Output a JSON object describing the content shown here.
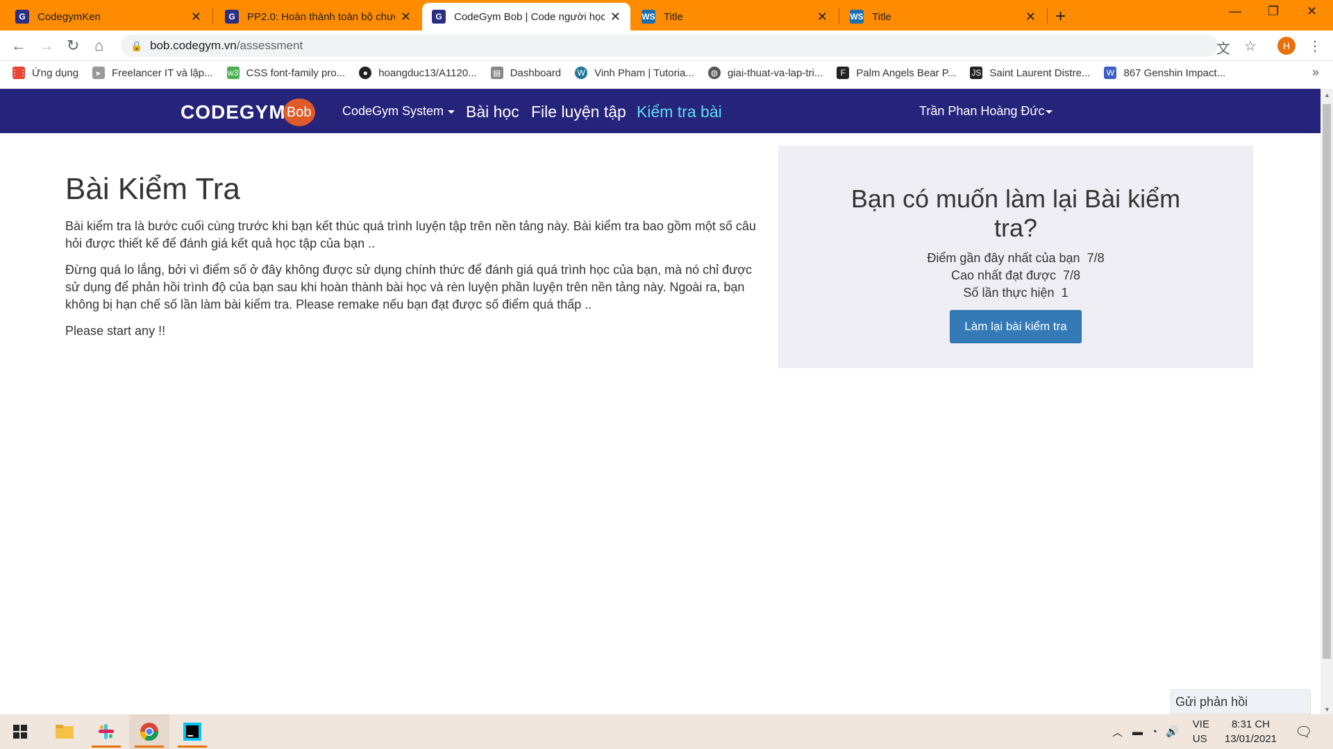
{
  "browser": {
    "tabs": [
      {
        "title": "CodegymKen",
        "icon": "codegym-favicon-icon"
      },
      {
        "title": "PP2.0: Hoàn thành toàn bộ chươ",
        "icon": "codegym-favicon-icon"
      },
      {
        "title": "CodeGym Bob | Code người học",
        "icon": "codegym-favicon-icon",
        "active": true
      },
      {
        "title": "Title",
        "icon": "webstorm-favicon-icon"
      },
      {
        "title": "Title",
        "icon": "webstorm-favicon-icon"
      }
    ],
    "address": {
      "domain": "bob.codegym.vn",
      "path": "/assessment"
    },
    "profile_initial": "H",
    "bookmarks": [
      {
        "label": "Ứng dụng",
        "icon": "apps-grid-icon"
      },
      {
        "label": "Freelancer IT và lập...",
        "icon": "freelancer-icon"
      },
      {
        "label": "CSS font-family pro...",
        "icon": "w3schools-icon"
      },
      {
        "label": "hoangduc13/A1120...",
        "icon": "github-icon"
      },
      {
        "label": "Dashboard",
        "icon": "dashboard-icon"
      },
      {
        "label": "Vinh Pham | Tutoria...",
        "icon": "wordpress-icon"
      },
      {
        "label": "giai-thuat-va-lap-tri...",
        "icon": "globe-icon"
      },
      {
        "label": "Palm Angels Bear P...",
        "icon": "farfetch-icon"
      },
      {
        "label": "Saint Laurent Distre...",
        "icon": "js-icon"
      },
      {
        "label": "867 Genshin Impact...",
        "icon": "w-icon"
      }
    ]
  },
  "site": {
    "logo_text": "CODEGYM",
    "logo_badge": "Bob",
    "nav": {
      "system": "CodeGym System",
      "lessons": "Bài học",
      "practice": "File luyện tập",
      "assessment": "Kiểm tra bài",
      "user": "Trần Phan Hoàng Đức"
    }
  },
  "main": {
    "title": "Bài Kiểm Tra",
    "paragraph1": "Bài kiểm tra là bước cuối cùng trước khi bạn kết thúc quá trình luyện tập trên nền tảng này. Bài kiểm tra bao gồm một số câu hỏi được thiết kế để đánh giá kết quả học tập của bạn ..",
    "paragraph2": "Đừng quá lo lắng, bởi vì điểm số ở đây không được sử dụng chính thức để đánh giá quá trình học của bạn, mà nó chỉ được sử dụng để phản hồi trình độ của bạn sau khi hoàn thành bài học và rèn luyện phần luyện trên nền tảng này. Ngoài ra, bạn không bị hạn chế số lần làm bài kiểm tra. Please remake nếu bạn đạt được số điểm quá thấp ..",
    "paragraph3": "Please start any !!"
  },
  "panel": {
    "title": "Bạn có muốn làm lại Bài kiểm tra?",
    "recent_label": "Điểm gần đây nhất của bạn",
    "recent_value": "7/8",
    "best_label": "Cao nhất đạt được",
    "best_value": "7/8",
    "attempts_label": "Số lần thực hiện",
    "attempts_value": "1",
    "retake_button": "Làm lại bài kiểm tra"
  },
  "feedback": "Gửi phản hồi",
  "taskbar": {
    "lang_top": "VIE",
    "lang_bottom": "US",
    "time": "8:31 CH",
    "date": "13/01/2021"
  }
}
